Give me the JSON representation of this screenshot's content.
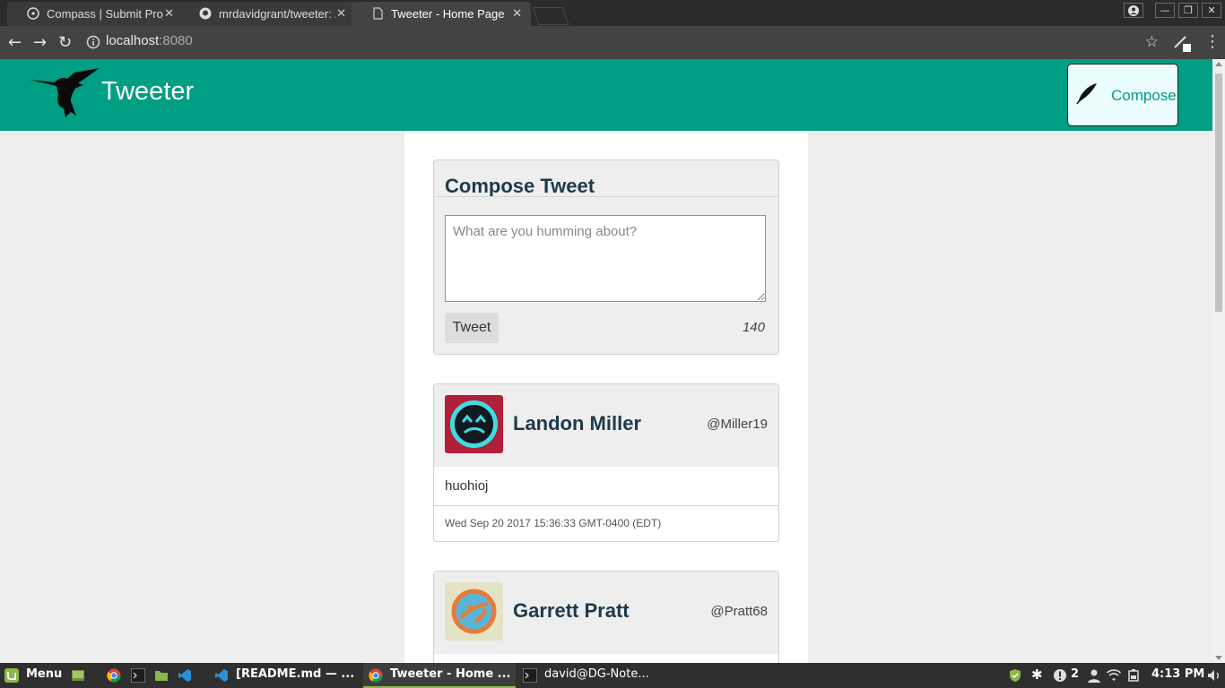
{
  "browser": {
    "tabs": [
      {
        "title": "Compass | Submit Proj",
        "icon": "compass-icon",
        "active": false
      },
      {
        "title": "mrdavidgrant/tweeter: /",
        "icon": "github-icon",
        "active": false
      },
      {
        "title": "Tweeter - Home Page",
        "icon": "page-icon",
        "active": true
      }
    ],
    "url_host": "localhost",
    "url_port": ":8080"
  },
  "colors": {
    "header_bg": "#009e82",
    "accent": "#009e82",
    "heading_text": "#1e3a4a",
    "avatar1_bg": "#b0203a",
    "avatar1_fg": "#3ddde0",
    "avatar2_bg": "#e5e3c5",
    "avatar2_fg": "#e87a3a",
    "avatar2_accent": "#5ab6d6"
  },
  "header": {
    "brand": "Tweeter",
    "compose_label": "Compose"
  },
  "compose": {
    "title": "Compose Tweet",
    "placeholder": "What are you humming about?",
    "button": "Tweet",
    "counter": "140"
  },
  "tweets": [
    {
      "name": "Landon Miller",
      "handle": "@Miller19",
      "body": "huohioj",
      "date": "Wed Sep 20 2017 15:36:33 GMT-0400 (EDT)"
    },
    {
      "name": "Garrett Pratt",
      "handle": "@Pratt68",
      "body": "",
      "date": ""
    }
  ],
  "taskbar": {
    "menu": "Menu",
    "windows": [
      {
        "label": "[README.md — ...",
        "icon": "vscode-icon"
      },
      {
        "label": "Tweeter - Home ...",
        "icon": "chrome-icon"
      },
      {
        "label": "david@DG-Note...",
        "icon": "terminal-icon"
      }
    ],
    "notification_count": "2",
    "clock": "4:13 PM"
  }
}
